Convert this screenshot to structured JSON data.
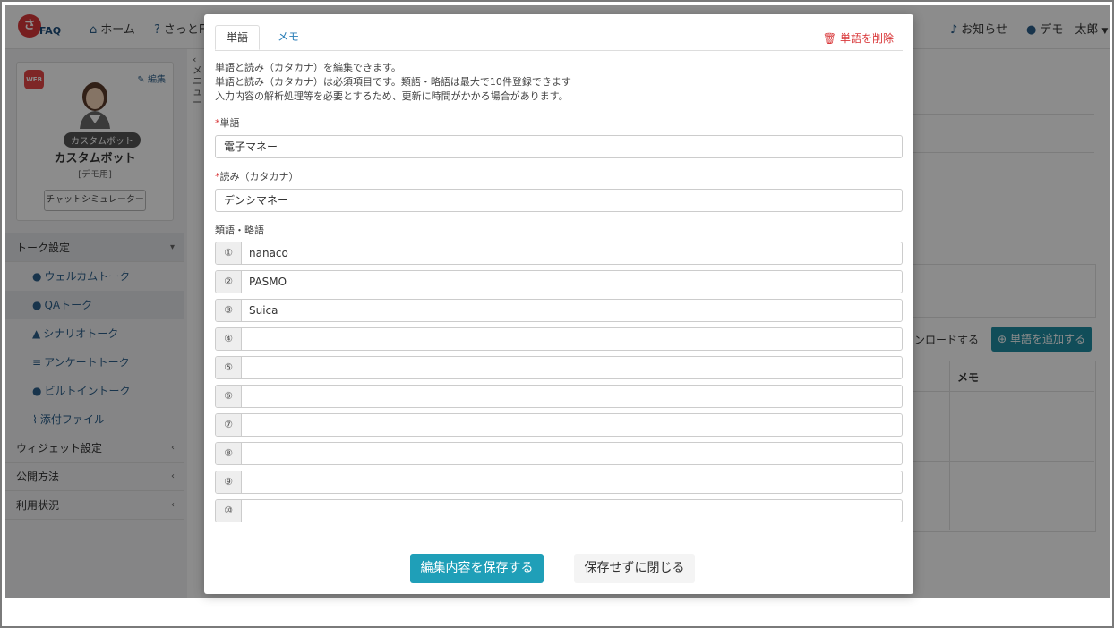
{
  "app": {
    "logo_char": "さ",
    "logo_text": "FAQ",
    "nav": {
      "home": "ホーム",
      "satto": "さっとF",
      "notice": "お知らせ",
      "user": "デモ　太郎"
    }
  },
  "sidebar": {
    "edit": "編集",
    "web_badge": "WEB",
    "bot_tag": "カスタムボット",
    "bot_name": "カスタムボット",
    "bot_sub": "[デモ用]",
    "simulator": "チャットシミュレーター",
    "collapsed_tab": "メニュー",
    "sections": [
      {
        "label": "トーク設定"
      },
      {
        "label": "ウィジェット設定"
      },
      {
        "label": "公開方法"
      },
      {
        "label": "利用状況"
      }
    ],
    "items": [
      {
        "label": "ウェルカムトーク"
      },
      {
        "label": "QAトーク"
      },
      {
        "label": "シナリオトーク"
      },
      {
        "label": "アンケートトーク"
      },
      {
        "label": "ビルトイントーク"
      },
      {
        "label": "添付ファイル"
      }
    ]
  },
  "background": {
    "download_text": "ンロードする",
    "add_word": "単語を追加する",
    "memo_header": "メモ"
  },
  "modal": {
    "tabs": {
      "word": "単語",
      "memo": "メモ"
    },
    "delete": "単語を削除",
    "notes": [
      "単語と読み（カタカナ）を編集できます。",
      "単語と読み（カタカナ）は必須項目です。類語・略語は最大で10件登録できます",
      "入力内容の解析処理等を必要とするため、更新に時間がかかる場合があります。"
    ],
    "word_label": "単語",
    "word_value": "電子マネー",
    "reading_label": "読み（カタカナ）",
    "reading_value": "デンシマネー",
    "synonyms_label": "類語・略語",
    "synonyms": [
      {
        "num": "①",
        "value": "nanaco"
      },
      {
        "num": "②",
        "value": "PASMO"
      },
      {
        "num": "③",
        "value": "Suica"
      },
      {
        "num": "④",
        "value": ""
      },
      {
        "num": "⑤",
        "value": ""
      },
      {
        "num": "⑥",
        "value": ""
      },
      {
        "num": "⑦",
        "value": ""
      },
      {
        "num": "⑧",
        "value": ""
      },
      {
        "num": "⑨",
        "value": ""
      },
      {
        "num": "⑩",
        "value": ""
      }
    ],
    "save": "編集内容を保存する",
    "close": "保存せずに閉じる"
  }
}
